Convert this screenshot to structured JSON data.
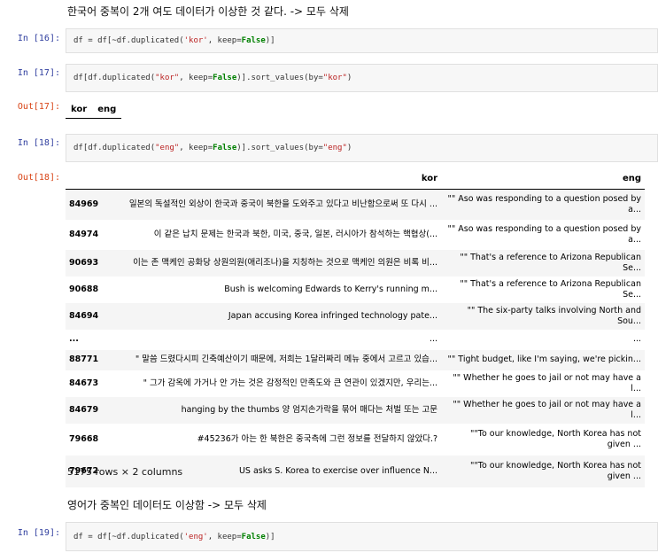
{
  "markdown1": "한국어 중복이 2개 여도 데이터가 이상한 것 같다. -> 모두 삭제",
  "markdown2": "영어가 중복인 데이터도 이상함 -> 모두 삭제",
  "prompts": {
    "in16": "In [16]:",
    "in17": "In [17]:",
    "out17": "Out[17]:",
    "in18": "In [18]:",
    "out18": "Out[18]:",
    "in19": "In [19]:"
  },
  "code16": {
    "p1": "df = df[~df.duplicated(",
    "s1": "'kor'",
    "p2": ", keep=",
    "k1": "False",
    "p3": ")]"
  },
  "code17": {
    "p1": "df[df.duplicated(",
    "s1": "\"kor\"",
    "p2": ", keep=",
    "k1": "False",
    "p3": ")].sort_values(by=",
    "s2": "\"kor\"",
    "p4": ")"
  },
  "code18": {
    "p1": "df[df.duplicated(",
    "s1": "\"eng\"",
    "p2": ", keep=",
    "k1": "False",
    "p3": ")].sort_values(by=",
    "s2": "\"eng\"",
    "p4": ")"
  },
  "code19": {
    "p1": "df = df[~df.duplicated(",
    "s1": "'eng'",
    "p2": ", keep=",
    "k1": "False",
    "p3": ")]"
  },
  "out17_table": {
    "col1": "kor",
    "col2": "eng"
  },
  "out18_table": {
    "col_kor": "kor",
    "col_eng": "eng",
    "rows": [
      {
        "idx": "84969",
        "kor": "일본의 독설적인 외상이 한국과 중국이 북한을 도와주고 있다고 비난함으로써 또 다시 ...",
        "eng": "\"\" Aso was responding to a question posed by a..."
      },
      {
        "idx": "84974",
        "kor": "이 같은 납치 문제는 한국과 북한, 미국, 중국, 일본, 러시아가 참석하는 핵협상(...",
        "eng": "\"\" Aso was responding to a question posed by a..."
      },
      {
        "idx": "90693",
        "kor": "이는 존 맥케인 공화당 상원의원(애리조나)을 지칭하는 것으로 맥케인 의원은 비록 비...",
        "eng": "\"\" That's a reference to Arizona Republican Se..."
      },
      {
        "idx": "90688",
        "kor": "Bush is welcoming Edwards to Kerry's running m...",
        "eng": "\"\" That's a reference to Arizona Republican Se..."
      },
      {
        "idx": "84694",
        "kor": "Japan accusing Korea infringed technology pate...",
        "eng": "\"\" The six-party talks involving North and Sou..."
      },
      {
        "idx": "...",
        "kor": "...",
        "eng": "..."
      },
      {
        "idx": "88771",
        "kor": "\" 말씀 드렸다시피 긴축예산이기 때문에, 저희는 1달러짜리 메뉴 중에서 고르고 있습...",
        "eng": "\"\" Tight budget, like I'm saying, we're pickin..."
      },
      {
        "idx": "84673",
        "kor": "\" 그가 감옥에 가거나 안 가는 것은 감정적인 만족도와 큰 연관이 있겠지만, 우리는...",
        "eng": "\"\" Whether he goes to jail or not may have a l..."
      },
      {
        "idx": "84679",
        "kor": "hanging by the thumbs 양 엄지손가락을 묶어 매다는 처벌 또는 고문",
        "eng": "\"\" Whether he goes to jail or not may have a l..."
      },
      {
        "idx": "79668",
        "kor": "#45236가 아는 한 북한은 중국측에 그런 정보를 전달하지 않았다.?",
        "eng": "\"\"To our knowledge, North Korea has not given ..."
      },
      {
        "idx": "79672",
        "kor": "US asks S. Korea to exercise over influence N...",
        "eng": "\"\"To our knowledge, North Korea has not given ..."
      }
    ],
    "footer": "5175 rows × 2 columns"
  }
}
